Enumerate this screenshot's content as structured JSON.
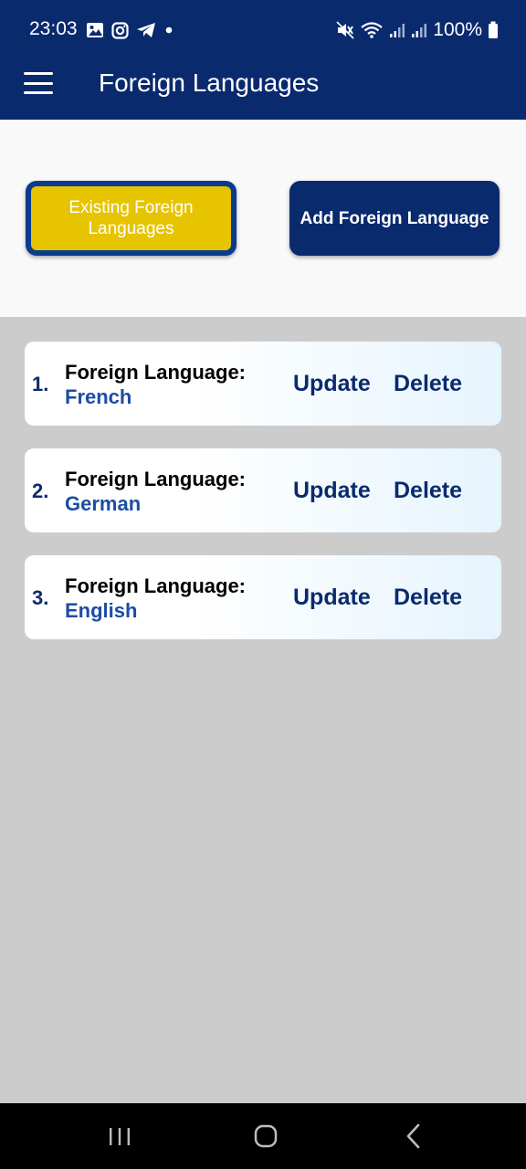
{
  "status_bar": {
    "time": "23:03",
    "left_icons": [
      "gallery-icon",
      "instagram-icon",
      "telegram-icon",
      "notification-dot-icon"
    ],
    "right_icons": [
      "mute-icon",
      "wifi-icon",
      "signal-icon",
      "signal-icon",
      "battery-icon"
    ],
    "battery": "100%"
  },
  "app_bar": {
    "title": "Foreign Languages",
    "menu_icon": "hamburger-menu-icon"
  },
  "tabs": {
    "existing_label": "Existing Foreign Languages",
    "add_label": "Add Foreign Language"
  },
  "languages": [
    {
      "index": "1.",
      "label": "Foreign Language:",
      "value": "French",
      "update": "Update",
      "delete": "Delete"
    },
    {
      "index": "2.",
      "label": "Foreign Language:",
      "value": "German",
      "update": "Update",
      "delete": "Delete"
    },
    {
      "index": "3.",
      "label": "Foreign Language:",
      "value": "English",
      "update": "Update",
      "delete": "Delete"
    }
  ],
  "nav_bar": {
    "icons": [
      "recents-icon",
      "home-icon",
      "back-icon"
    ]
  },
  "colors": {
    "primary": "#0a2a6e",
    "accent_yellow": "#e6c400",
    "value_blue": "#1c4da3",
    "background": "#cccccc"
  }
}
